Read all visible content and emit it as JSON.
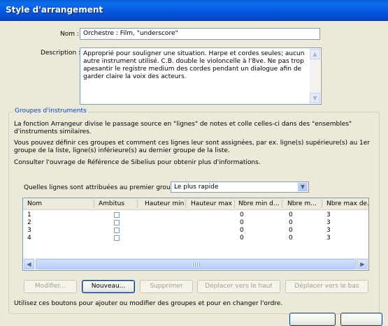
{
  "window": {
    "title": "Style d'arrangement"
  },
  "form": {
    "name_label": "Nom :",
    "name_value": "Orchestre : Film, \"underscore\"",
    "description_label": "Description :",
    "description_value": "Approprié pour souligner une situation. Harpe et cordes seules; aucun autre instrument utilisé. C.B. double le violoncelle à l'8ve. Ne pas trop apesantir le registre medium des cordes pendant un dialogue afin de garder claire la voix des acteurs."
  },
  "groups": {
    "title": "Groupes d'instruments",
    "para1": "La fonction Arrangeur divise le passage source en \"lignes\" de notes et colle celles-ci dans des \"ensembles\" d'instruments similaires.",
    "para2": "Vous pouvez définir ces groupes et comment ces lignes leur sont assignées, par ex. ligne(s) supérieure(s) au 1er groupe de la liste, ligne(s) inférieure(s) au dernier groupe de la liste.",
    "para3": "Consulter l'ouvrage de Référence de Sibelius pour obtenir plus d'informations.",
    "first_group_label": "Quelles lignes sont attribuées au premier groupe :",
    "first_group_value": "Le plus rapide",
    "columns": [
      "Nom",
      "Ambitus",
      "Hauteur min",
      "Hauteur max",
      "Nbre min d...",
      "Nbre m...",
      "Nbre max de..."
    ],
    "rows": [
      {
        "nom": "1",
        "min_d": "0",
        "m": "0",
        "max_de": "3"
      },
      {
        "nom": "2",
        "min_d": "0",
        "m": "0",
        "max_de": "3"
      },
      {
        "nom": "3",
        "min_d": "0",
        "m": "0",
        "max_de": "3"
      },
      {
        "nom": "4",
        "min_d": "0",
        "m": "0",
        "max_de": "3"
      }
    ],
    "buttons": {
      "modify": "Modifier...",
      "new": "Nouveau...",
      "delete": "Supprimer",
      "move_up": "Déplacer vers le haut",
      "move_down": "Déplacer vers le bas"
    },
    "hint": "Utilisez ces boutons pour ajouter ou modifier des groupes et pour en changer l'ordre."
  },
  "icons": {
    "scroll_up": "chevron-up-icon",
    "scroll_down": "chevron-down-icon",
    "scroll_left": "chevron-left-icon",
    "scroll_right": "chevron-right-icon",
    "dropdown": "chevron-down-icon"
  },
  "colors": {
    "titlebar": "#0555dc",
    "group_title": "#0046d5",
    "dialog_bg": "#ece9d8"
  }
}
